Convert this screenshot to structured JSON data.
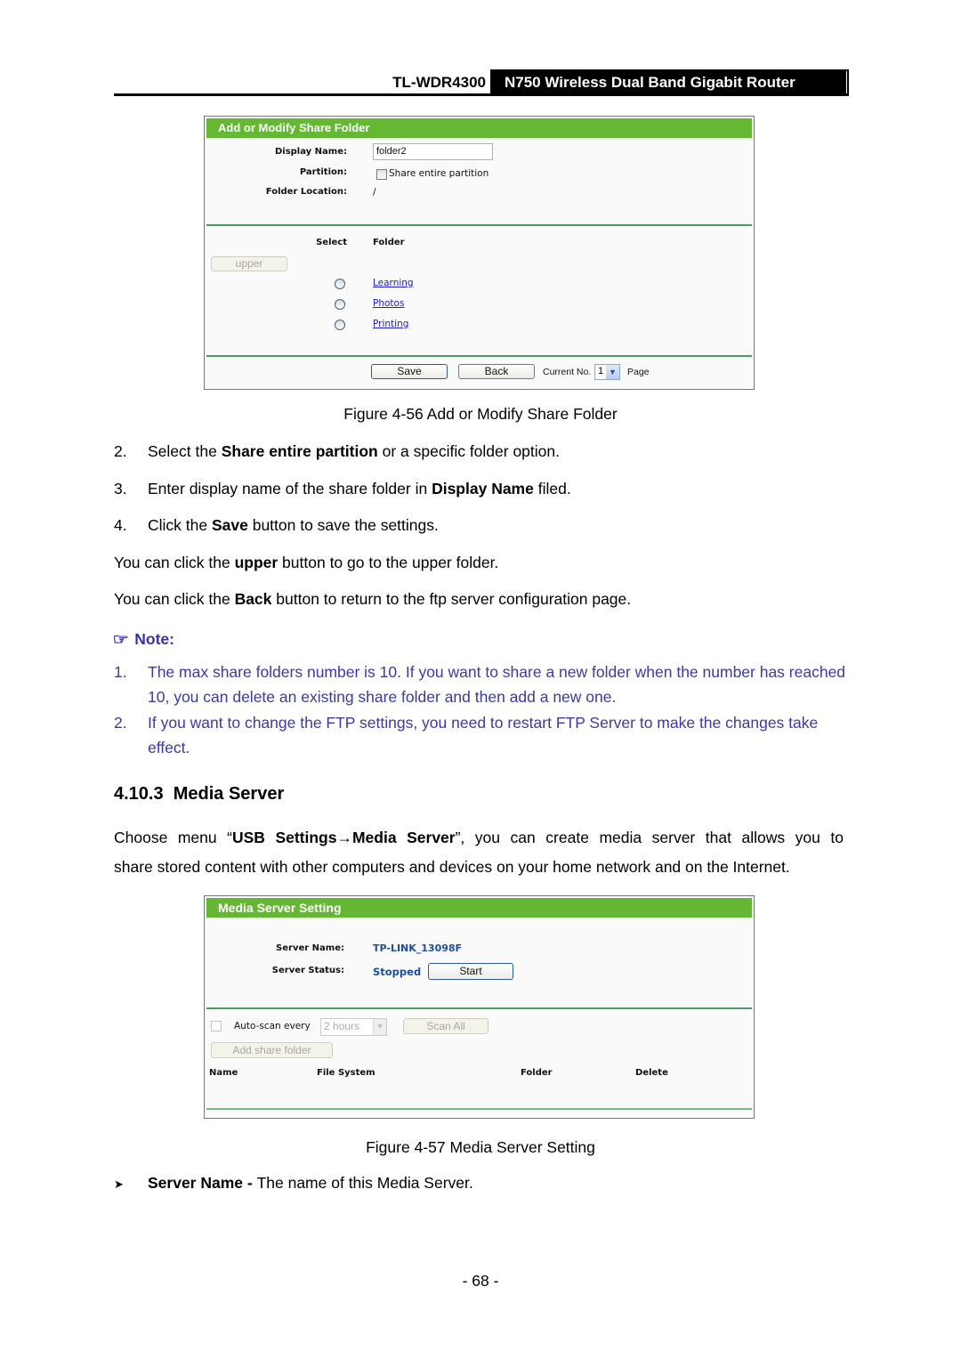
{
  "header": {
    "model": "TL-WDR4300",
    "product": "N750 Wireless Dual Band Gigabit Router"
  },
  "figure56": {
    "panel_title": "Add or Modify Share Folder",
    "display_name_label": "Display Name:",
    "display_name_value": "folder2",
    "partition_label": "Partition:",
    "share_entire_partition_label": "Share entire partition",
    "share_entire_partition_checked": false,
    "folder_location_label": "Folder Location:",
    "folder_location_value": "/",
    "select_header": "Select",
    "folder_header": "Folder",
    "upper_button": "upper",
    "folders": [
      {
        "name": "Learning",
        "selected": false
      },
      {
        "name": "Photos",
        "selected": false
      },
      {
        "name": "Printing",
        "selected": false
      }
    ],
    "save_button": "Save",
    "back_button": "Back",
    "current_no_label": "Current No.",
    "current_no_value": "1",
    "page_label": "Page",
    "caption": "Figure 4-56 Add or Modify Share Folder"
  },
  "steps": [
    {
      "num": "2.",
      "pre": "Select the ",
      "bold": "Share entire partition",
      "post": " or a specific folder option."
    },
    {
      "num": "3.",
      "pre": "Enter display name of the share folder in ",
      "bold": "Display Name",
      "post": " filed."
    },
    {
      "num": "4.",
      "pre": "Click the ",
      "bold": "Save",
      "post": " button to save the settings."
    }
  ],
  "paragraphs": [
    {
      "pre": "You can click the ",
      "bold": "upper",
      "post": " button to go to the upper folder."
    },
    {
      "pre": "You can click the ",
      "bold": "Back",
      "post": " button to return to the ftp server configuration page."
    }
  ],
  "note": {
    "icon": "pointing-hand-icon",
    "title": "Note:",
    "items": [
      {
        "num": "1.",
        "text": "The max share folders number is 10. If you want to share a new folder when the number has reached 10, you can delete an existing share folder and then add a new one."
      },
      {
        "num": "2.",
        "text": "If you want to change the FTP settings, you need to restart FTP Server to make the changes take effect."
      }
    ]
  },
  "section": {
    "number": "4.10.3",
    "title": "Media Server",
    "intro_pre": "Choose menu “",
    "intro_bold1": "USB Settings",
    "intro_arrow": "→",
    "intro_bold2": "Media Server",
    "intro_post_line1": "”, you can create media server that allows you to",
    "intro_line2": "share stored content with other computers and devices on your home network and on the Internet."
  },
  "figure57": {
    "panel_title": "Media Server Setting",
    "server_name_label": "Server Name:",
    "server_name_value": "TP-LINK_13098F",
    "server_status_label": "Server Status:",
    "server_status_value": "Stopped",
    "start_button": "Start",
    "auto_scan_label": "Auto-scan every",
    "auto_scan_checked": false,
    "auto_scan_interval": "2 hours",
    "scan_all_button": "Scan All",
    "add_share_folder_button": "Add share folder",
    "table_headers": [
      "Name",
      "File System",
      "Folder",
      "Delete"
    ],
    "table_rows": [],
    "accent_color": "#64b834",
    "status_color": "#1d4fa0",
    "caption": "Figure 4-57 Media Server Setting"
  },
  "bullet": {
    "bold": "Server Name - ",
    "text": "The name of this Media Server."
  },
  "page_number": "- 68 -"
}
